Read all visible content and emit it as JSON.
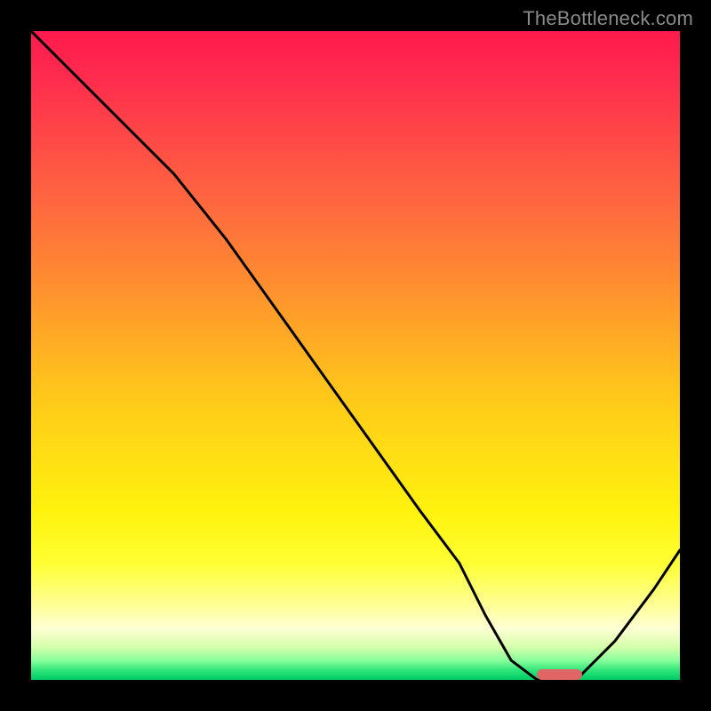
{
  "watermark": "TheBottleneck.com",
  "colors": {
    "background": "#000000",
    "curve_stroke": "#000000",
    "marker_fill": "#e06666",
    "watermark_color": "#8a8a8a",
    "gradient_top": "#ff1a4d",
    "gradient_bottom": "#00cc66"
  },
  "chart_data": {
    "type": "line",
    "title": "",
    "xlabel": "",
    "ylabel": "",
    "xlim": [
      0,
      100
    ],
    "ylim": [
      0,
      100
    ],
    "grid": false,
    "axes_visible": false,
    "series": [
      {
        "name": "bottleneck-curve",
        "x": [
          0,
          15,
          22,
          30,
          40,
          50,
          60,
          66,
          70,
          74,
          78,
          84,
          90,
          96,
          100
        ],
        "values": [
          100,
          85,
          78,
          68,
          54,
          40,
          26,
          18,
          10,
          3,
          0,
          0,
          6,
          14,
          20
        ]
      }
    ],
    "marker": {
      "name": "highlight-segment",
      "x_start": 78,
      "x_end": 85,
      "y": 0
    },
    "background_gradient": {
      "orientation": "vertical",
      "stops": [
        {
          "pos": 0,
          "color": "#ff1a4d"
        },
        {
          "pos": 0.26,
          "color": "#ff6640"
        },
        {
          "pos": 0.56,
          "color": "#ffc71a"
        },
        {
          "pos": 0.82,
          "color": "#ffff33"
        },
        {
          "pos": 0.95,
          "color": "#d4ffaa"
        },
        {
          "pos": 1.0,
          "color": "#00cc66"
        }
      ]
    }
  }
}
